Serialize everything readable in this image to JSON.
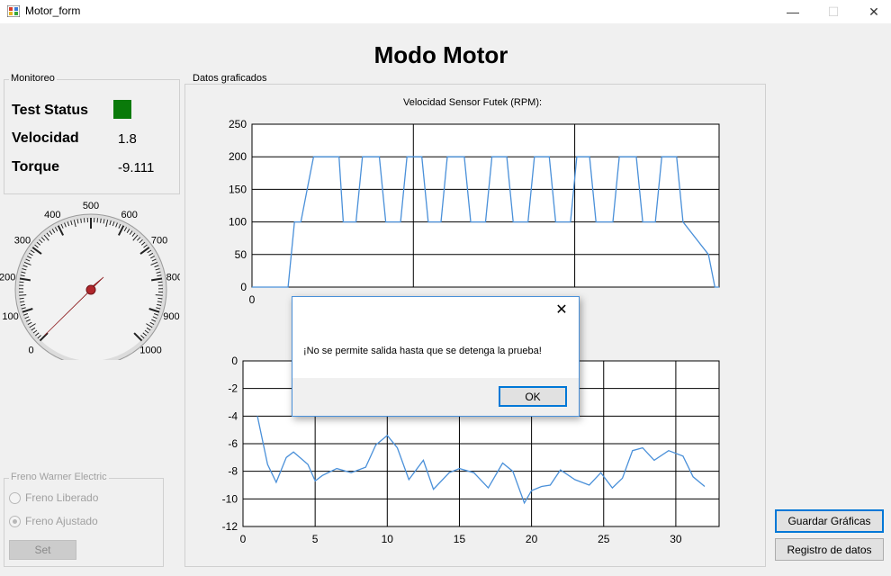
{
  "window": {
    "title": "Motor_form",
    "minimize": "—",
    "maximize": "☐",
    "close": "✕"
  },
  "heading": "Modo Motor",
  "monitoreo": {
    "legend": "Monitoreo",
    "status_label": "Test Status",
    "status_color": "#0a7a0a",
    "velocidad_label": "Velocidad",
    "velocidad_value": "1.8",
    "torque_label": "Torque",
    "torque_value": "-9.111"
  },
  "gauge": {
    "labels": [
      "0",
      "100",
      "200",
      "300",
      "400",
      "500",
      "600",
      "700",
      "800",
      "900",
      "1000"
    ],
    "min": 0,
    "max": 1000,
    "needle_value": 1.8
  },
  "freno": {
    "legend": "Freno Warner Electric",
    "option1": "Freno Liberado",
    "option2": "Freno Ajustado",
    "selected": "Freno Ajustado",
    "set_label": "Set"
  },
  "datos": {
    "legend": "Datos graficados"
  },
  "chart_data": [
    {
      "type": "line",
      "title": "Velocidad Sensor Futek (RPM):",
      "ylim": [
        0,
        250
      ],
      "yticks": [
        0,
        50,
        100,
        150,
        200,
        250
      ],
      "xticks": [
        0
      ],
      "series": [
        {
          "color": "#4a90d9",
          "x": [
            0,
            1.7,
            2.0,
            2.3,
            2.6,
            2.9,
            3.3,
            4.1,
            4.3,
            4.9,
            5.2,
            6.0,
            6.3,
            7.0,
            7.3,
            8.0,
            8.3,
            8.9,
            9.2,
            10.0,
            10.3,
            11.0,
            11.3,
            12.0,
            12.3,
            13.0,
            13.3,
            14.0,
            14.3,
            15.0,
            15.3,
            15.9,
            16.2,
            17.0,
            17.3,
            18.1,
            18.4,
            19.0,
            19.3,
            20.0,
            20.3,
            21.5,
            21.8,
            22.0
          ],
          "y": [
            0,
            0,
            100,
            100,
            150,
            200,
            200,
            200,
            100,
            100,
            200,
            200,
            100,
            100,
            200,
            200,
            100,
            100,
            200,
            200,
            100,
            100,
            200,
            200,
            100,
            100,
            200,
            200,
            100,
            100,
            200,
            200,
            100,
            100,
            200,
            200,
            100,
            100,
            200,
            200,
            100,
            50,
            0,
            0
          ]
        }
      ]
    },
    {
      "type": "line",
      "title": "",
      "ylim": [
        -12,
        0
      ],
      "xlim": [
        0,
        33
      ],
      "yticks": [
        0,
        -2,
        -4,
        -6,
        -8,
        -10,
        -12
      ],
      "xticks": [
        0,
        5,
        10,
        15,
        20,
        25,
        30
      ],
      "series": [
        {
          "color": "#4a90d9",
          "x": [
            1,
            1.7,
            2.3,
            3,
            3.5,
            4.5,
            5,
            5.5,
            6.5,
            7.5,
            8.5,
            9.2,
            10,
            10.7,
            11.5,
            12.5,
            13.2,
            14.3,
            15,
            16,
            17,
            18,
            18.7,
            19.5,
            20,
            20.7,
            21.3,
            22,
            23,
            24,
            24.8,
            25.6,
            26.3,
            27,
            27.7,
            28.5,
            29.5,
            30.5,
            31.2,
            32
          ],
          "y": [
            -4,
            -7.5,
            -8.8,
            -7,
            -6.6,
            -7.5,
            -8.7,
            -8.3,
            -7.8,
            -8.1,
            -7.7,
            -6.1,
            -5.4,
            -6.3,
            -8.6,
            -7.2,
            -9.3,
            -8.1,
            -7.8,
            -8.1,
            -9.2,
            -7.4,
            -8,
            -10.3,
            -9.4,
            -9.1,
            -9,
            -7.9,
            -8.6,
            -9,
            -8.1,
            -9.2,
            -8.5,
            -6.5,
            -6.3,
            -7.2,
            -6.5,
            -6.9,
            -8.4,
            -9.1
          ]
        }
      ]
    }
  ],
  "buttons": {
    "guardar": "Guardar Gráficas",
    "registro": "Registro de datos"
  },
  "dialog": {
    "message": "¡No se permite salida hasta que se detenga la prueba!",
    "ok": "OK",
    "close": "✕"
  }
}
